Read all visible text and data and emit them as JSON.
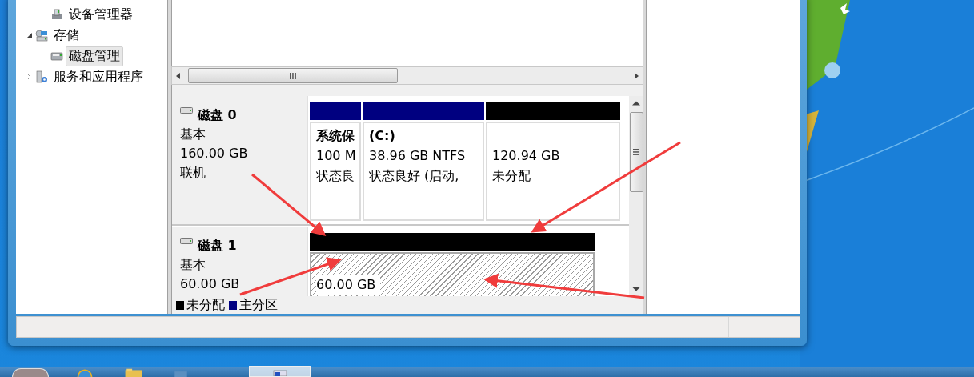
{
  "tree": {
    "items": [
      {
        "label": "设备管理器",
        "kind": "device"
      },
      {
        "label": "存储",
        "kind": "storage",
        "expanded": true,
        "children": [
          {
            "label": "磁盘管理",
            "kind": "disk",
            "selected": true
          }
        ]
      },
      {
        "label": "服务和应用程序",
        "kind": "services",
        "expanded": false
      }
    ]
  },
  "disks": [
    {
      "name": "磁盘 0",
      "type": "基本",
      "size": "160.00 GB",
      "status": "联机",
      "partitions": [
        {
          "kind": "primary",
          "title": "系统保",
          "size": "100 M",
          "status": "状态良"
        },
        {
          "kind": "primary",
          "title": "(C:)",
          "size": "38.96 GB NTFS",
          "status": "状态良好 (启动,"
        },
        {
          "kind": "unallocated",
          "size": "120.94 GB",
          "status": "未分配"
        }
      ]
    },
    {
      "name": "磁盘 1",
      "type": "基本",
      "size": "60.00 GB",
      "partitions": [
        {
          "kind": "unallocated",
          "size": "60.00 GB"
        }
      ]
    }
  ],
  "legend": [
    {
      "kind": "unallocated",
      "label": "未分配",
      "color": "#000000"
    },
    {
      "kind": "primary",
      "label": "主分区",
      "color": "#000080"
    }
  ]
}
